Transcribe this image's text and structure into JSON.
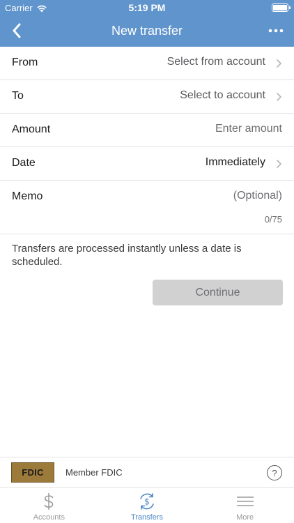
{
  "status_bar": {
    "carrier": "Carrier",
    "time": "5:19 PM"
  },
  "nav": {
    "title": "New transfer",
    "back_icon": "chevron-left-icon",
    "more_icon": "more-dots-icon"
  },
  "form": {
    "from": {
      "label": "From",
      "value": "Select from account"
    },
    "to": {
      "label": "To",
      "value": "Select to account"
    },
    "amount": {
      "label": "Amount",
      "placeholder": "Enter amount"
    },
    "date": {
      "label": "Date",
      "value": "Immediately"
    },
    "memo": {
      "label": "Memo",
      "placeholder": "(Optional)",
      "counter": "0/75"
    }
  },
  "info_text": "Transfers are processed instantly unless a date is scheduled.",
  "continue_label": "Continue",
  "footer": {
    "logo_text": "FDIC",
    "member_text": "Member FDIC",
    "help_label": "?"
  },
  "tabs": [
    {
      "label": "Accounts",
      "icon": "dollar-icon",
      "active": false
    },
    {
      "label": "Transfers",
      "icon": "transfer-icon",
      "active": true
    },
    {
      "label": "More",
      "icon": "menu-icon",
      "active": false
    }
  ],
  "colors": {
    "header": "#6094cc",
    "active_tab": "#4a86c5",
    "button_disabled": "#d1d1d1"
  }
}
